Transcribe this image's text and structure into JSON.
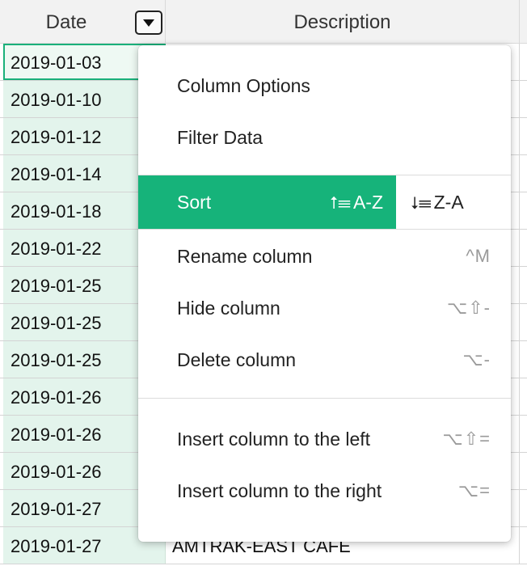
{
  "header": {
    "date_label": "Date",
    "description_label": "Description"
  },
  "rows": [
    {
      "date": "2019-01-03",
      "description": ""
    },
    {
      "date": "2019-01-10",
      "description": ""
    },
    {
      "date": "2019-01-12",
      "description": ""
    },
    {
      "date": "2019-01-14",
      "description": ""
    },
    {
      "date": "2019-01-18",
      "description": ""
    },
    {
      "date": "2019-01-22",
      "description": ""
    },
    {
      "date": "2019-01-25",
      "description": ""
    },
    {
      "date": "2019-01-25",
      "description": ""
    },
    {
      "date": "2019-01-25",
      "description": ""
    },
    {
      "date": "2019-01-26",
      "description": ""
    },
    {
      "date": "2019-01-26",
      "description": ""
    },
    {
      "date": "2019-01-26",
      "description": ""
    },
    {
      "date": "2019-01-27",
      "description": ""
    },
    {
      "date": "2019-01-27",
      "description": "AMTRAK-EAST CAFE"
    }
  ],
  "menu": {
    "column_options": "Column Options",
    "filter_data": "Filter Data",
    "sort": "Sort",
    "sort_az_icon": "⭡☰",
    "sort_az": "A-Z",
    "sort_za_icon": "⭣☰",
    "sort_za": "Z-A",
    "rename_column": "Rename column",
    "rename_shortcut": "^M",
    "hide_column": "Hide column",
    "hide_shortcut": "⌥⇧-",
    "delete_column": "Delete column",
    "delete_shortcut": "⌥-",
    "insert_left": "Insert column to the left",
    "insert_left_shortcut": "⌥⇧=",
    "insert_right": "Insert column to the right",
    "insert_right_shortcut": "⌥="
  },
  "colors": {
    "accent": "#16b37a",
    "date_column_bg": "#e3f4ec"
  },
  "icons": {
    "column_menu": "dropdown-triangle-icon",
    "sort_ascending": "sort-ascending-icon",
    "sort_descending": "sort-descending-icon"
  }
}
